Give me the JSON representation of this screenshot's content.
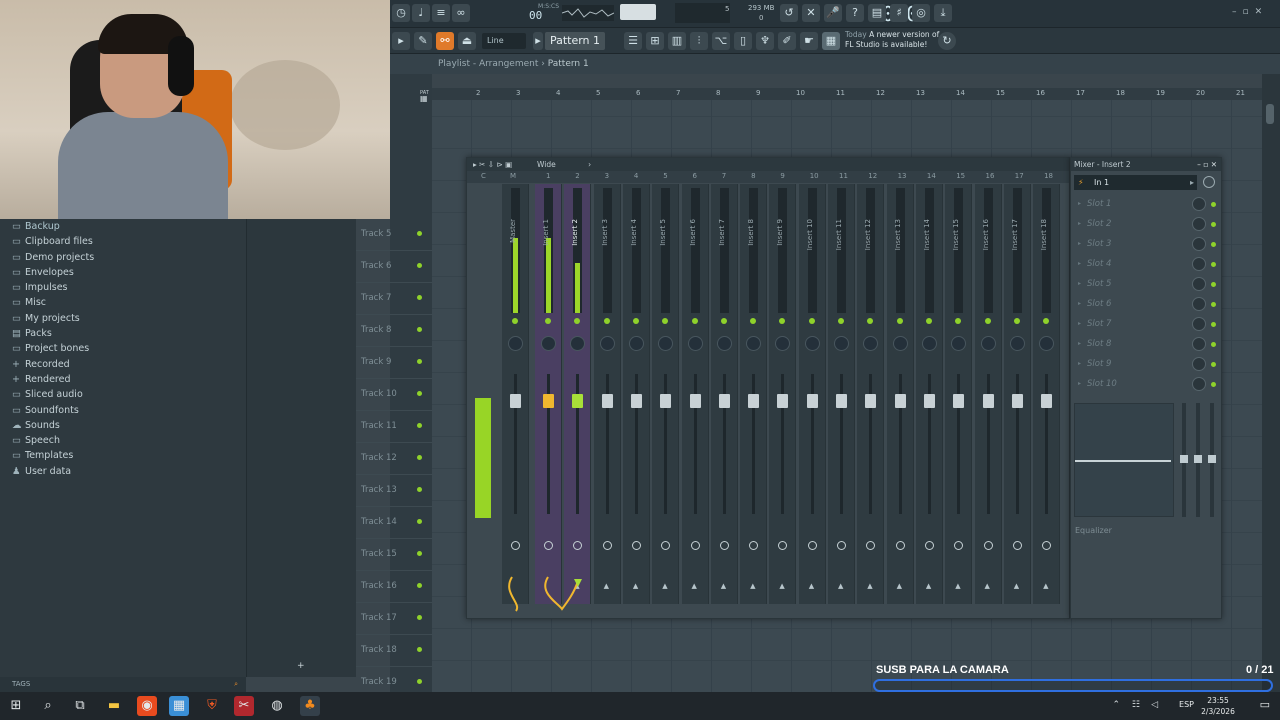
{
  "toolbar": {
    "time": "0:00",
    "time_fraction": "00",
    "time_unit": "M:S:CS",
    "pattern": "Pattern 1",
    "snap": "Line",
    "memory": "293 MB",
    "cpu_voices": "5",
    "cpu_zero": "0",
    "news_label": "Today",
    "news_text": "A newer version of FL Studio is available!"
  },
  "playlist": {
    "title": "Playlist - Arrangement",
    "separator": "›",
    "pattern": "Pattern 1",
    "ruler": [
      "2",
      "3",
      "4",
      "5",
      "6",
      "7",
      "8",
      "9",
      "10",
      "11",
      "12",
      "13",
      "14",
      "15",
      "16",
      "17",
      "18",
      "19",
      "20",
      "21"
    ],
    "tracks": [
      "Track 5",
      "Track 6",
      "Track 7",
      "Track 8",
      "Track 9",
      "Track 10",
      "Track 11",
      "Track 12",
      "Track 13",
      "Track 14",
      "Track 15",
      "Track 16",
      "Track 17",
      "Track 18",
      "Track 19"
    ]
  },
  "browser": {
    "items": [
      {
        "label": "Backup",
        "icon": "folder-icon"
      },
      {
        "label": "Clipboard files",
        "icon": "folder-icon"
      },
      {
        "label": "Demo projects",
        "icon": "folder-icon"
      },
      {
        "label": "Envelopes",
        "icon": "folder-icon"
      },
      {
        "label": "Impulses",
        "icon": "folder-icon"
      },
      {
        "label": "Misc",
        "icon": "folder-icon"
      },
      {
        "label": "My projects",
        "icon": "folder-icon"
      },
      {
        "label": "Packs",
        "icon": "packs-icon"
      },
      {
        "label": "Project bones",
        "icon": "folder-icon"
      },
      {
        "label": "Recorded",
        "icon": "plus-folder-icon"
      },
      {
        "label": "Rendered",
        "icon": "plus-folder-icon"
      },
      {
        "label": "Sliced audio",
        "icon": "folder-icon"
      },
      {
        "label": "Soundfonts",
        "icon": "folder-icon"
      },
      {
        "label": "Sounds",
        "icon": "cloud-icon"
      },
      {
        "label": "Speech",
        "icon": "folder-icon"
      },
      {
        "label": "Templates",
        "icon": "folder-icon"
      },
      {
        "label": "User data",
        "icon": "user-icon"
      }
    ],
    "tags_label": "TAGS"
  },
  "mixer": {
    "view": "Wide",
    "numbers": [
      "C",
      "M",
      "1",
      "2",
      "3",
      "4",
      "5",
      "6",
      "7",
      "8",
      "9",
      "10",
      "11",
      "12",
      "13",
      "14",
      "15",
      "16",
      "17",
      "18"
    ],
    "strips": [
      "Master",
      "Insert 1",
      "Insert 2",
      "Insert 3",
      "Insert 4",
      "Insert 5",
      "Insert 6",
      "Insert 7",
      "Insert 8",
      "Insert 9",
      "Insert 10",
      "Insert 11",
      "Insert 12",
      "Insert 13",
      "Insert 14",
      "Insert 15",
      "Insert 16",
      "Insert 17",
      "Insert 18"
    ]
  },
  "insert_panel": {
    "title": "Mixer - Insert 2",
    "input": "In 1",
    "slots": [
      "Slot 1",
      "Slot 2",
      "Slot 3",
      "Slot 4",
      "Slot 5",
      "Slot 6",
      "Slot 7",
      "Slot 8",
      "Slot 9",
      "Slot 10"
    ],
    "equalizer_label": "Equalizer"
  },
  "overlay": {
    "banner": "SUSB PARA LA CAMARA",
    "counter": "0 / 21",
    "accent": "#2f6fe0"
  },
  "taskbar": {
    "language": "ESP",
    "time": "23:55",
    "date": "2/3/2026"
  },
  "colors": {
    "meter_green": "#9dd62a",
    "selected_strip": "#4a3f62",
    "fader_active": "#f0b72f"
  }
}
